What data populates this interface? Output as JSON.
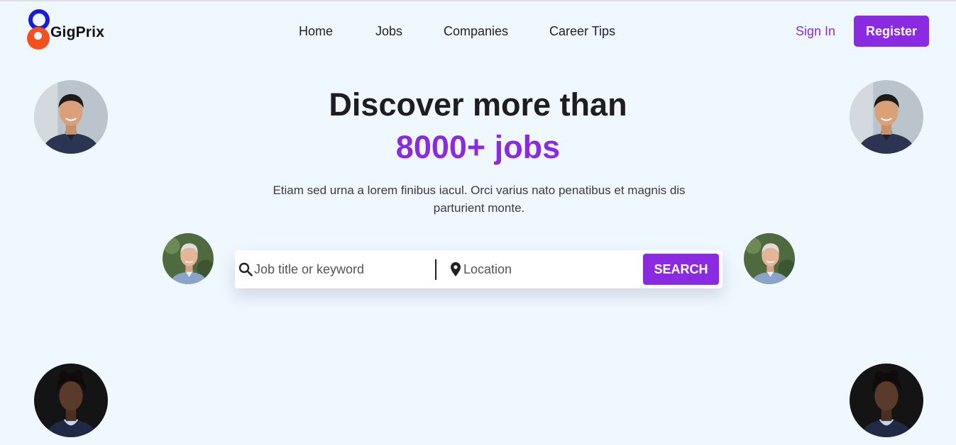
{
  "brand": {
    "name": "GigPrix"
  },
  "nav": {
    "items": [
      {
        "label": "Home"
      },
      {
        "label": "Jobs"
      },
      {
        "label": "Companies"
      },
      {
        "label": "Career Tips"
      }
    ]
  },
  "auth": {
    "signin_label": "Sign In",
    "register_label": "Register"
  },
  "hero": {
    "headline_line1": "Discover more than",
    "headline_line2": "8000+ jobs",
    "subtitle": "Etiam sed urna a lorem finibus iacul. Orci varius nato penatibus et magnis dis parturient monte."
  },
  "search": {
    "keyword_placeholder": "Job title or keyword",
    "keyword_value": "",
    "location_placeholder": "Location",
    "location_value": "",
    "button_label": "SEARCH",
    "keyword_icon": "search-icon",
    "location_icon": "map-pin-icon"
  },
  "colors": {
    "accent": "#8a2be2",
    "background": "#eff7ff",
    "logo_blue": "#1a1adb",
    "logo_orange": "#f4511e"
  }
}
